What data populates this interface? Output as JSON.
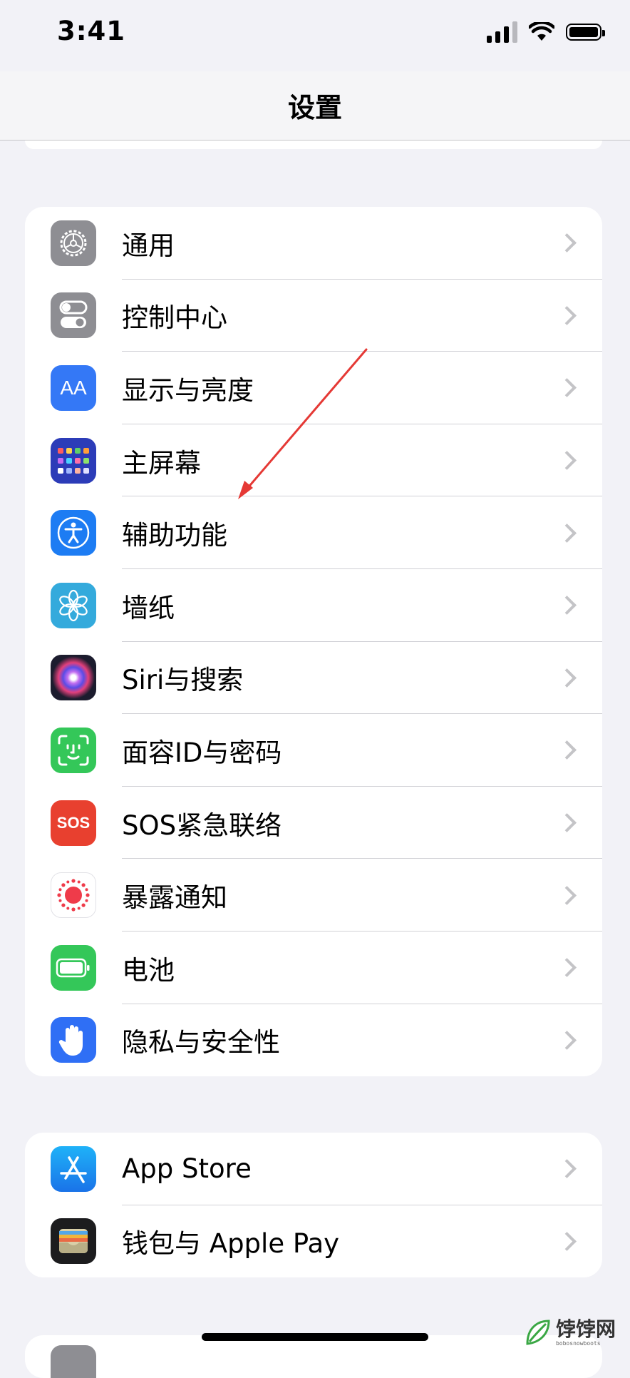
{
  "status": {
    "time": "3:41"
  },
  "nav": {
    "title": "设置"
  },
  "groups": [
    {
      "rows": [
        {
          "label": "通用",
          "icon": "gear-icon"
        },
        {
          "label": "控制中心",
          "icon": "toggle-icon"
        },
        {
          "label": "显示与亮度",
          "icon": "text-size-icon",
          "icon_text": "AA"
        },
        {
          "label": "主屏幕",
          "icon": "app-grid-icon"
        },
        {
          "label": "辅助功能",
          "icon": "accessibility-icon"
        },
        {
          "label": "墙纸",
          "icon": "flower-icon"
        },
        {
          "label": "Siri与搜索",
          "icon": "siri-icon"
        },
        {
          "label": "面容ID与密码",
          "icon": "face-id-icon"
        },
        {
          "label": "SOS紧急联络",
          "icon": "sos-icon",
          "icon_text": "SOS"
        },
        {
          "label": "暴露通知",
          "icon": "exposure-icon"
        },
        {
          "label": "电池",
          "icon": "battery-icon"
        },
        {
          "label": "隐私与安全性",
          "icon": "hand-icon"
        }
      ]
    },
    {
      "rows": [
        {
          "label": "App Store",
          "icon": "app-store-icon"
        },
        {
          "label": "钱包与 Apple Pay",
          "icon": "wallet-icon"
        }
      ]
    }
  ],
  "watermark": {
    "name": "饽饽网",
    "sub": "bobosnowboots"
  },
  "colors": {
    "background": "#f2f2f7",
    "annotation_arrow": "#e53935",
    "chevron": "#c4c4c7"
  }
}
